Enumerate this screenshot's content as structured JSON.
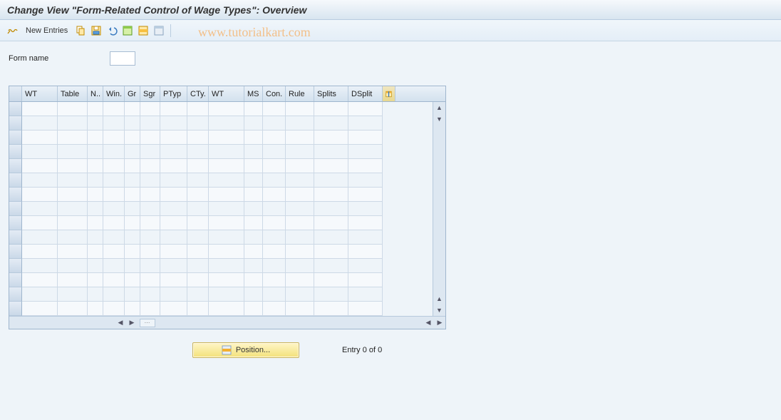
{
  "title": "Change View \"Form-Related Control of Wage Types\": Overview",
  "toolbar": {
    "new_entries": "New Entries"
  },
  "watermark": "www.tutorialkart.com",
  "form": {
    "name_label": "Form name",
    "name_value": ""
  },
  "table": {
    "columns": {
      "wt1": "WT",
      "table": "Table",
      "n": "N..",
      "win": "Win.",
      "gr": "Gr",
      "sgr": "Sgr",
      "ptyp": "PTyp",
      "cty": "CTy.",
      "wt2": "WT",
      "ms": "MS",
      "con": "Con.",
      "rule": "Rule",
      "splits": "Splits",
      "dsplit": "DSplit"
    },
    "row_count": 15
  },
  "footer": {
    "position_label": "Position...",
    "entry_status": "Entry 0 of 0"
  },
  "icon_names": {
    "glasses": "display-icon",
    "copy": "copy-icon",
    "save": "save-icon",
    "undo": "undo-icon",
    "select_all": "select-all-icon",
    "select_block": "select-block-icon",
    "deselect_all": "deselect-all-icon",
    "config": "table-settings-icon"
  }
}
